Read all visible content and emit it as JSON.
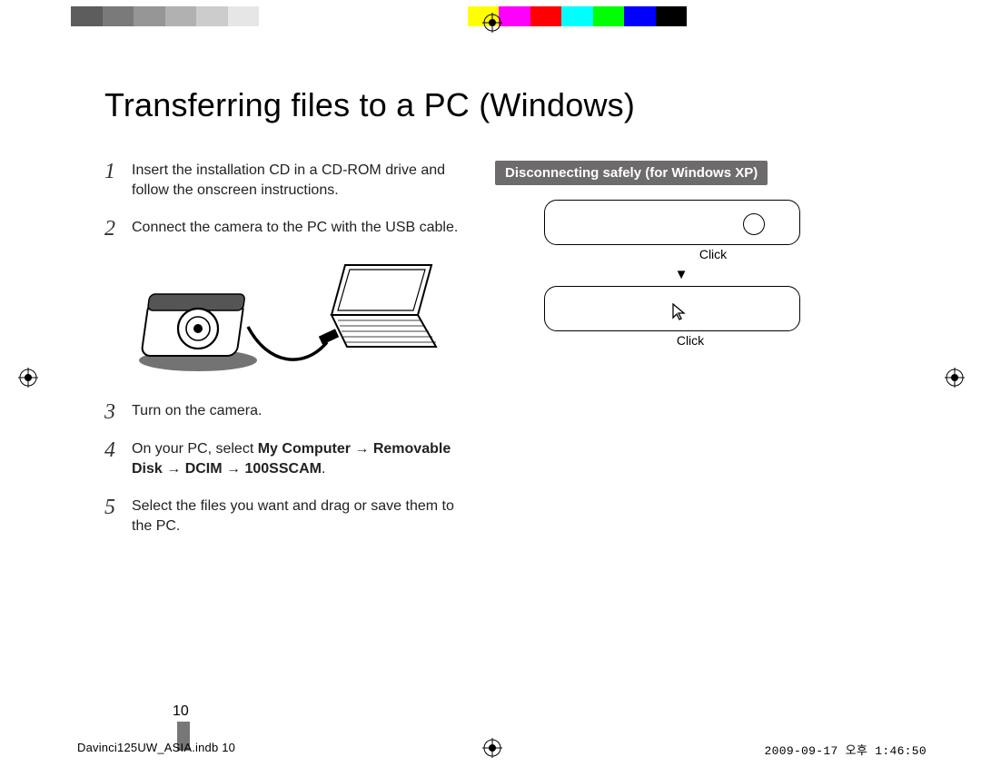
{
  "color_bar": {
    "left": [
      "#5d5d5d",
      "#7a7a7a",
      "#969696",
      "#b1b1b1",
      "#cccccc",
      "#e6e6e6",
      "#ffffff"
    ],
    "right": [
      "#ffff00",
      "#ff00ff",
      "#ff0000",
      "#00ffff",
      "#00ff00",
      "#0000ff",
      "#000000"
    ]
  },
  "title": "Transferring files to a PC (Windows)",
  "steps": [
    {
      "num": "1",
      "html": "Insert the installation CD in a CD-ROM drive and follow the onscreen instructions."
    },
    {
      "num": "2",
      "html": "Connect the camera to the PC with the USB cable."
    },
    {
      "num": "3",
      "html": "Turn on the camera."
    },
    {
      "num": "4",
      "html": "On your PC, select <b>My Computer</b> → <b>Removable Disk</b> → <b>DCIM</b> → <b>100SSCAM</b>."
    },
    {
      "num": "5",
      "html": "Select the files you want and drag or save them to the PC."
    }
  ],
  "disconnect": {
    "heading": "Disconnecting safely (for Windows XP)",
    "click1": "Click",
    "arrow": "▼",
    "click2": "Click"
  },
  "page_number": "10",
  "footer": {
    "left": "Davinci125UW_ASIA.indb   10",
    "right": "2009-09-17   오후 1:46:50"
  }
}
